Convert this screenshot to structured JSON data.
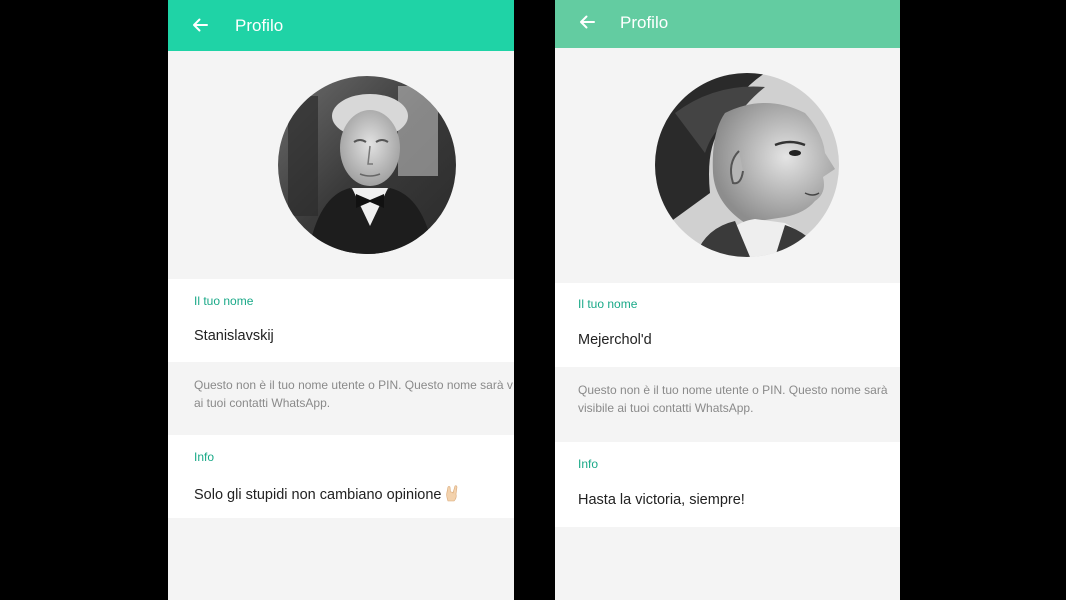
{
  "left": {
    "appbar": {
      "title": "Profilo"
    },
    "name_section": {
      "label": "Il tuo nome",
      "value": "Stanislavskij"
    },
    "hint": {
      "line1": "Questo non è il tuo nome utente o PIN. Questo nome sarà v",
      "line2": "ai tuoi contatti WhatsApp."
    },
    "info_section": {
      "label": "Info",
      "value": "Solo gli stupidi non cambiano opinione",
      "emoji": "sign-of-the-horns"
    },
    "colors": {
      "appbar": "#1fd3a6",
      "accent": "#1aa988"
    }
  },
  "right": {
    "appbar": {
      "title": "Profilo"
    },
    "name_section": {
      "label": "Il tuo nome",
      "value": "Mejerchol'd"
    },
    "hint": {
      "line1": "Questo non è il tuo nome utente o PIN. Questo nome sarà",
      "line2": "visibile ai tuoi contatti WhatsApp."
    },
    "info_section": {
      "label": "Info",
      "value": "Hasta la victoria, siempre!"
    },
    "colors": {
      "appbar": "#63cca1",
      "accent": "#1aa988"
    }
  }
}
